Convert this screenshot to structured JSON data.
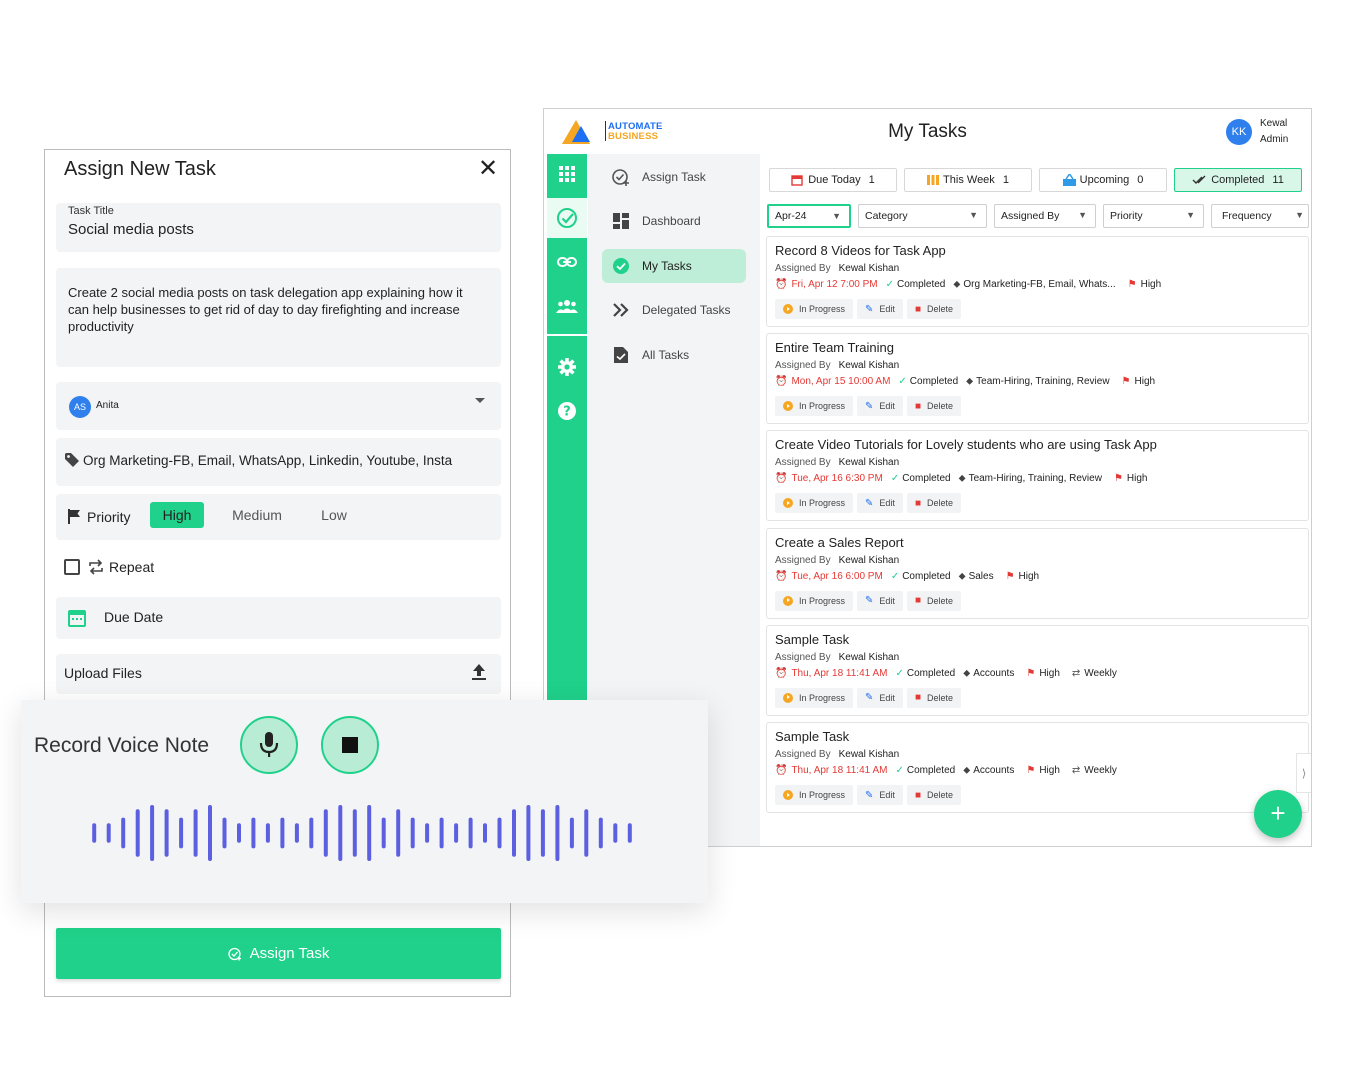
{
  "app": {
    "logo_line1": "AUTOMATE",
    "logo_line2": "BUSINESS",
    "title": "My Tasks",
    "user_initials": "KK",
    "user_name": "Kewal",
    "user_role": "Admin"
  },
  "rail_icons": [
    "grid-icon",
    "check-circle-icon",
    "link-icon",
    "team-icon",
    "settings-icon",
    "help-icon"
  ],
  "sidenav": [
    {
      "label": "Assign Task",
      "icon": "assign-task-icon"
    },
    {
      "label": "Dashboard",
      "icon": "dashboard-icon"
    },
    {
      "label": "My Tasks",
      "icon": "check-icon",
      "active": true
    },
    {
      "label": "Delegated Tasks",
      "icon": "double-chevron-icon"
    },
    {
      "label": "All Tasks",
      "icon": "document-check-icon"
    }
  ],
  "tabs": [
    {
      "label": "Due Today",
      "count": "1",
      "icon": "calendar-icon"
    },
    {
      "label": "This Week",
      "count": "1",
      "icon": "week-icon"
    },
    {
      "label": "Upcoming",
      "count": "0",
      "icon": "upcoming-icon"
    },
    {
      "label": "Completed",
      "count": "11",
      "icon": "double-check-icon"
    }
  ],
  "filters": {
    "month": "Apr-24",
    "category": "Category",
    "assigned_by": "Assigned By",
    "priority": "Priority",
    "frequency": "Frequency"
  },
  "task_labels": {
    "assigned_by": "Assigned By",
    "in_progress": "In Progress",
    "edit": "Edit",
    "delete": "Delete"
  },
  "tasks": [
    {
      "title": "Record 8 Videos for Task App",
      "assigned_by": "Kewal Kishan",
      "due": "Fri, Apr 12 7:00 PM",
      "status": "Completed",
      "category": "Org Marketing-FB, Email, Whats...",
      "priority": "High",
      "repeat": ""
    },
    {
      "title": "Entire Team Training",
      "assigned_by": "Kewal Kishan",
      "due": "Mon, Apr 15 10:00 AM",
      "status": "Completed",
      "category": "Team-Hiring, Training, Review",
      "priority": "High",
      "repeat": ""
    },
    {
      "title": "Create Video Tutorials for Lovely students who are using Task App",
      "assigned_by": "Kewal Kishan",
      "due": "Tue, Apr 16 6:30 PM",
      "status": "Completed",
      "category": "Team-Hiring, Training, Review",
      "priority": "High",
      "repeat": ""
    },
    {
      "title": "Create a Sales Report",
      "assigned_by": "Kewal Kishan",
      "due": "Tue, Apr 16 6:00 PM",
      "status": "Completed",
      "category": "Sales",
      "priority": "High",
      "repeat": ""
    },
    {
      "title": "Sample Task",
      "assigned_by": "Kewal Kishan",
      "due": "Thu, Apr 18 11:41 AM",
      "status": "Completed",
      "category": "Accounts",
      "priority": "High",
      "repeat": "Weekly"
    },
    {
      "title": "Sample Task",
      "assigned_by": "Kewal Kishan",
      "due": "Thu, Apr 18 11:41 AM",
      "status": "Completed",
      "category": "Accounts",
      "priority": "High",
      "repeat": "Weekly"
    }
  ],
  "fab_label": "+",
  "dialog": {
    "title": "Assign New Task",
    "close": "✕",
    "task_title_label": "Task Title",
    "task_title_value": "Social media posts",
    "description": "Create 2 social media posts on task delegation app explaining how it can help businesses to get rid of day to day firefighting and increase productivity",
    "assignee_initials": "AS",
    "assignee_name": "Anita",
    "category": "Org Marketing-FB, Email, WhatsApp, Linkedin, Youtube, Insta",
    "priority_label": "Priority",
    "priority_options": [
      "High",
      "Medium",
      "Low"
    ],
    "priority_selected": "High",
    "repeat_label": "Repeat",
    "repeat_checked": false,
    "due_date_label": "Due Date",
    "upload_label": "Upload Files",
    "assign_button": "Assign Task"
  },
  "voice": {
    "label": "Record Voice Note",
    "mic_icon": "microphone-icon",
    "stop_icon": "stop-icon",
    "wave_levels": [
      0.35,
      0.35,
      0.55,
      0.85,
      1.0,
      0.85,
      0.55,
      0.85,
      1.0,
      0.55,
      0.35,
      0.55,
      0.35,
      0.55,
      0.35,
      0.55,
      0.85,
      1.0,
      0.85,
      1.0,
      0.55,
      0.85,
      0.55,
      0.35,
      0.55,
      0.35,
      0.55,
      0.35,
      0.55,
      0.85,
      1.0,
      0.85,
      1.0,
      0.55,
      0.85,
      0.55,
      0.35,
      0.35
    ]
  },
  "colors": {
    "accent": "#1fd18a",
    "wave": "#5b5fe0",
    "danger": "#e53935",
    "link": "#1e6ff1"
  }
}
